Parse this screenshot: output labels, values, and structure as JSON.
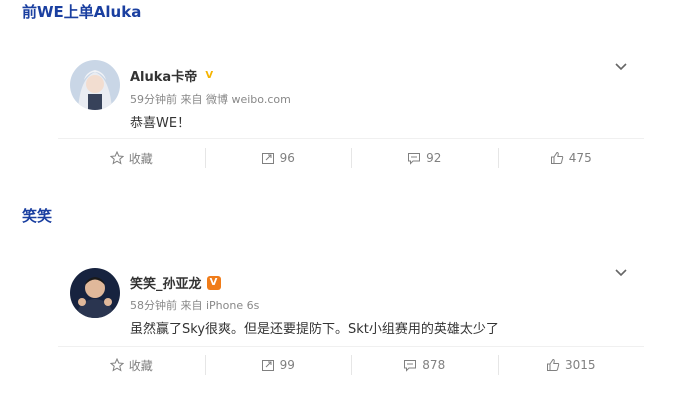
{
  "sections": [
    {
      "heading": "前WE上单Aluka",
      "post": {
        "author": "Aluka卡帝",
        "verified": "V",
        "verified_color": "#f5b400",
        "meta": "59分钟前 来自 微博 weibo.com",
        "text": "恭喜WE！",
        "actions": {
          "favorite": "收藏",
          "repost": "96",
          "comment": "92",
          "like": "475"
        }
      }
    },
    {
      "heading": "笑笑",
      "post": {
        "author": "笑笑_孙亚龙",
        "verified": "V",
        "verified_color": "#f07c19",
        "meta": "58分钟前 来自 iPhone 6s",
        "text": "虽然赢了Sky很爽。但是还要提防下。Skt小组赛用的英雄太少了",
        "actions": {
          "favorite": "收藏",
          "repost": "99",
          "comment": "878",
          "like": "3015"
        }
      }
    }
  ],
  "colors": {
    "heading": "#1a3fa0",
    "muted": "#808080"
  },
  "icons": [
    "star-icon",
    "repost-icon",
    "comment-icon",
    "thumbs-up-icon",
    "chevron-down-icon"
  ]
}
